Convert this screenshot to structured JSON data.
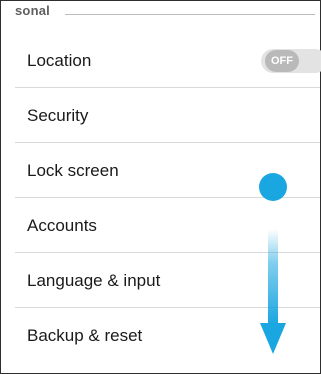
{
  "section": {
    "label": "sonal"
  },
  "items": [
    {
      "label": "Location",
      "toggle": "OFF"
    },
    {
      "label": "Security"
    },
    {
      "label": "Lock screen"
    },
    {
      "label": "Accounts"
    },
    {
      "label": "Language & input"
    },
    {
      "label": "Backup & reset"
    }
  ],
  "colors": {
    "gesture": "#1aa6e0",
    "toggle_off": "#b9b9b9"
  },
  "gesture_icons": [
    "touch-point-icon",
    "swipe-down-arrow-icon"
  ]
}
